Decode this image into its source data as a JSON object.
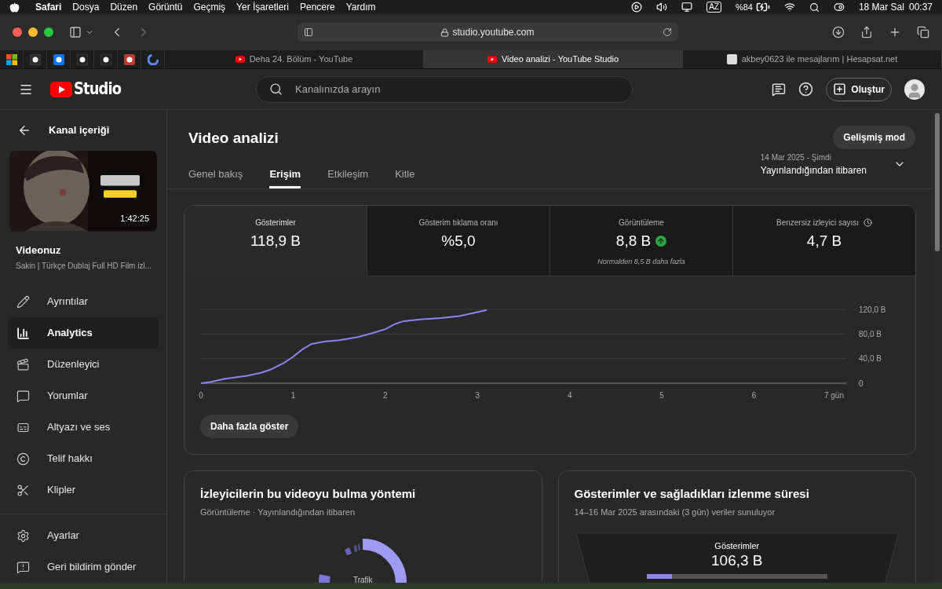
{
  "menubar": {
    "app": "Safari",
    "menus": [
      "Dosya",
      "Düzen",
      "Görüntü",
      "Geçmiş",
      "Yer İşaretleri",
      "Pencere",
      "Yardım"
    ],
    "input_source": "AZ",
    "battery": "%84",
    "date": "18 Mar Sal",
    "time": "00:37"
  },
  "browser": {
    "address": "studio.youtube.com",
    "tabs": [
      {
        "title": "Deha 24. Bölüm - YouTube",
        "selected": false,
        "kind": "youtube"
      },
      {
        "title": "Video analizi - YouTube Studio",
        "selected": true,
        "kind": "youtube"
      },
      {
        "title": "akbey0623 ile mesajlarım | Hesapsat.net",
        "selected": false,
        "kind": "site"
      }
    ]
  },
  "header": {
    "logo": "Studio",
    "search": {
      "placeholder": "Kanalınızda arayın"
    },
    "create_button": "Oluştur"
  },
  "sidebar": {
    "back": "Kanal içeriği",
    "video": {
      "duration": "1:42:25",
      "label": "Videonuz",
      "title": "Sakin | Türkçe Dublaj Full HD Film izl..."
    },
    "items": [
      {
        "label": "Ayrıntılar",
        "selected": false
      },
      {
        "label": "Analytics",
        "selected": true
      },
      {
        "label": "Düzenleyici",
        "selected": false
      },
      {
        "label": "Yorumlar",
        "selected": false
      },
      {
        "label": "Altyazı ve ses",
        "selected": false
      },
      {
        "label": "Telif hakkı",
        "selected": false
      },
      {
        "label": "Klipler",
        "selected": false
      }
    ],
    "footer_items": [
      "Ayarlar",
      "Geri bildirim gönder"
    ]
  },
  "page": {
    "title": "Video analizi",
    "advanced_button": "Gelişmiş mod",
    "tabs": [
      {
        "label": "Genel bakış",
        "selected": false
      },
      {
        "label": "Erişim",
        "selected": true
      },
      {
        "label": "Etkileşim",
        "selected": false
      },
      {
        "label": "Kitle",
        "selected": false
      }
    ],
    "date_range": {
      "dates": "14 Mar 2025 - Şimdi",
      "label": "Yayınlandığından itibaren"
    }
  },
  "metrics": [
    {
      "label": "Gösterimler",
      "value": "118,9 B",
      "selected": true,
      "kind": "plain"
    },
    {
      "label": "Gösterim tıklama oranı",
      "value": "%5,0",
      "selected": false,
      "kind": "plain"
    },
    {
      "label": "Görüntüleme",
      "value": "8,8 B",
      "selected": false,
      "kind": "trend",
      "note": "Normalden 8,5 B daha fazla"
    },
    {
      "label": "Benzersiz izleyici sayısı",
      "value": "4,7 B",
      "selected": false,
      "kind": "info"
    }
  ],
  "chart": {
    "chart_data": {
      "type": "line",
      "x": [
        0,
        0.1,
        0.25,
        0.5,
        0.65,
        0.75,
        0.9,
        1.0,
        1.1,
        1.2,
        1.35,
        1.5,
        1.7,
        1.85,
        2.0,
        2.1,
        2.2,
        2.4,
        2.6,
        2.8,
        2.95,
        3.1
      ],
      "values": [
        0,
        2,
        7,
        12,
        17,
        22,
        33,
        43,
        55,
        64,
        68,
        70,
        75,
        81,
        88,
        96,
        101,
        104,
        106,
        109,
        114,
        119
      ],
      "xlim": [
        0,
        7
      ],
      "ylim": [
        0,
        120
      ],
      "xticks": [
        0,
        1,
        2,
        3,
        4,
        5,
        6,
        {
          "value": 7,
          "label": "7 gün"
        }
      ],
      "yticks": [
        0,
        {
          "value": 40,
          "label": "40,0 B"
        },
        {
          "value": 80,
          "label": "80,0 B"
        },
        {
          "value": 120,
          "label": "120,0 B"
        }
      ]
    },
    "more_button": "Daha fazla göster"
  },
  "cards": [
    {
      "kind": "donut",
      "title": "İzleyicilerin bu videoyu bulma yöntemi",
      "subtitle": "Görüntüleme · Yayınlandığından itibaren",
      "center_label": "Trafik"
    },
    {
      "kind": "funnel",
      "title": "Gösterimler ve sağladıkları izlenme süresi",
      "subtitle": "14–16 Mar 2025 arasındaki (3 gün) veriler sunuluyor",
      "stage_label": "Gösterimler",
      "stage_value": "106,3 B",
      "level": 0.14
    }
  ]
}
